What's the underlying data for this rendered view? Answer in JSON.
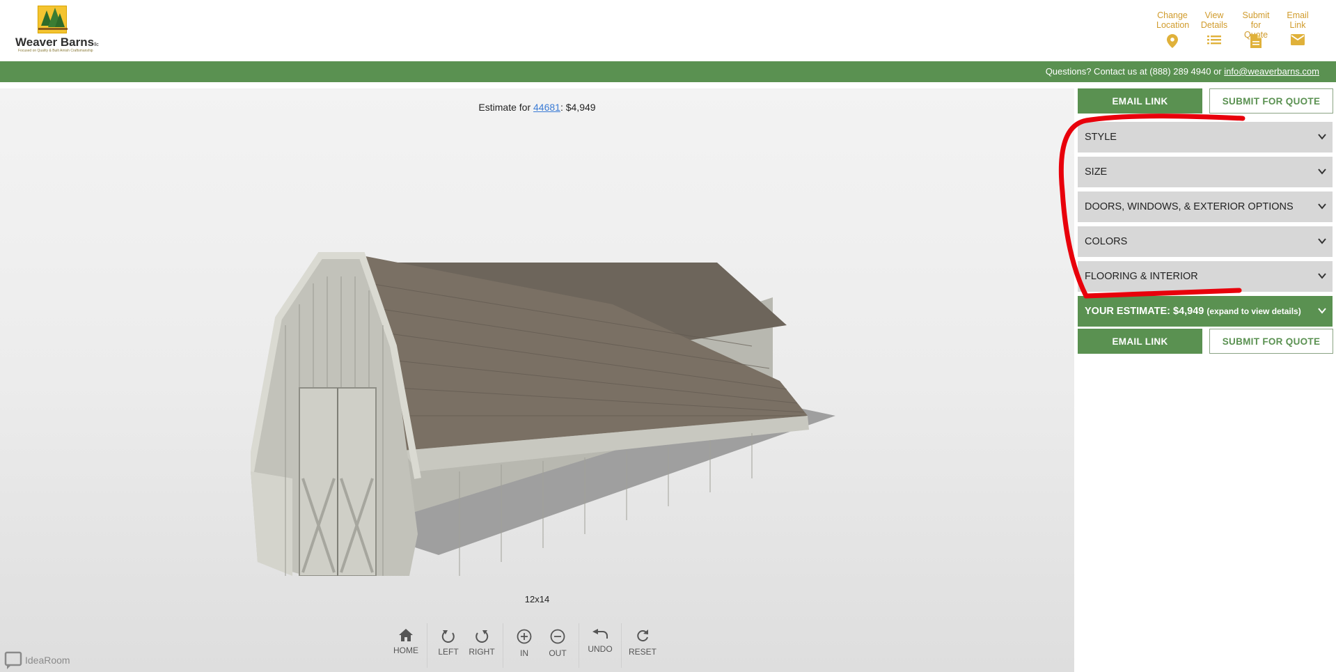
{
  "brand": {
    "name": "Weaver Barns",
    "name_suffix": "llc",
    "tagline": "Focused on Quality & Built Amish Craftsmanship"
  },
  "top_links": [
    {
      "line1": "Change",
      "line2": "Location",
      "icon": "location-pin-icon"
    },
    {
      "line1": "View",
      "line2": "Details",
      "icon": "list-icon"
    },
    {
      "line1": "Submit",
      "line2": "for Quote",
      "icon": "document-icon"
    },
    {
      "line1": "Email",
      "line2": "Link",
      "icon": "envelope-icon"
    }
  ],
  "contact": {
    "text": "Questions? Contact us at (888) 289 4940 or ",
    "email": "info@weaverbarns.com"
  },
  "viewer": {
    "estimate_prefix": "Estimate for ",
    "zip": "44681",
    "estimate_suffix": ": $4,949",
    "size": "12x14",
    "controls": {
      "home": "HOME",
      "left": "LEFT",
      "right": "RIGHT",
      "in": "IN",
      "out": "OUT",
      "undo": "UNDO",
      "reset": "RESET"
    },
    "watermark": "IdeaRoom"
  },
  "sidebar": {
    "email_link": "EMAIL LINK",
    "submit_quote": "SUBMIT FOR QUOTE",
    "sections": [
      "STYLE",
      "SIZE",
      "DOORS, WINDOWS, & EXTERIOR OPTIONS",
      "COLORS",
      "FLOORING & INTERIOR"
    ],
    "estimate_label": "YOUR ESTIMATE: $4,949",
    "estimate_hint": "(expand to view details)"
  },
  "colors": {
    "brand_green": "#5a9151",
    "accent_gold": "#d09b2c",
    "panel_gray": "#d7d7d7",
    "annotation_red": "#e8000b"
  }
}
